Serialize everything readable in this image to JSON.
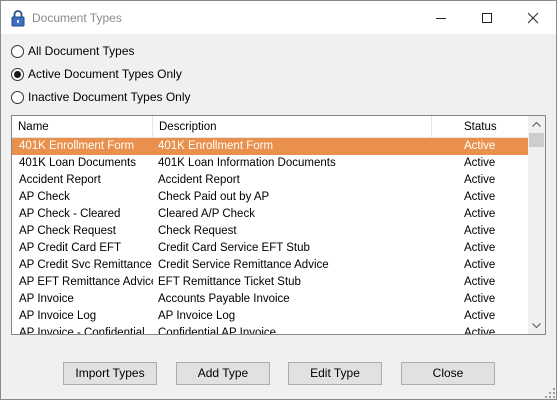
{
  "window": {
    "title": "Document Types",
    "icon": "lock-icon"
  },
  "filter": {
    "options": [
      {
        "label": "All Document Types",
        "checked": false
      },
      {
        "label": "Active Document Types Only",
        "checked": true
      },
      {
        "label": "Inactive Document Types Only",
        "checked": false
      }
    ]
  },
  "list": {
    "columns": {
      "name": "Name",
      "description": "Description",
      "status": "Status"
    },
    "selected_color": "#e9904c",
    "rows": [
      {
        "name": "401K Enrollment Form",
        "description": "401K Enrollment Form",
        "status": "Active",
        "selected": true
      },
      {
        "name": "401K Loan Documents",
        "description": "401K Loan Information Documents",
        "status": "Active"
      },
      {
        "name": "Accident Report",
        "description": "Accident Report",
        "status": "Active"
      },
      {
        "name": "AP Check",
        "description": "Check Paid out by AP",
        "status": "Active"
      },
      {
        "name": "AP Check - Cleared",
        "description": "Cleared A/P Check",
        "status": "Active"
      },
      {
        "name": "AP Check Request",
        "description": "Check Request",
        "status": "Active"
      },
      {
        "name": "AP Credit Card EFT",
        "description": "Credit Card Service EFT Stub",
        "status": "Active"
      },
      {
        "name": "AP Credit Svc Remittance",
        "description": "Credit Service Remittance Advice",
        "status": "Active"
      },
      {
        "name": "AP EFT Remittance Advice",
        "description": "EFT Remittance Ticket Stub",
        "status": "Active"
      },
      {
        "name": "AP Invoice",
        "description": "Accounts Payable Invoice",
        "status": "Active"
      },
      {
        "name": "AP Invoice  Log",
        "description": "AP Invoice Log",
        "status": "Active"
      },
      {
        "name": "AP Invoice - Confidential",
        "description": "Confidential AP Invoice",
        "status": "Active"
      }
    ]
  },
  "buttons": {
    "import": "Import Types",
    "add": "Add Type",
    "edit": "Edit Type",
    "close": "Close"
  }
}
